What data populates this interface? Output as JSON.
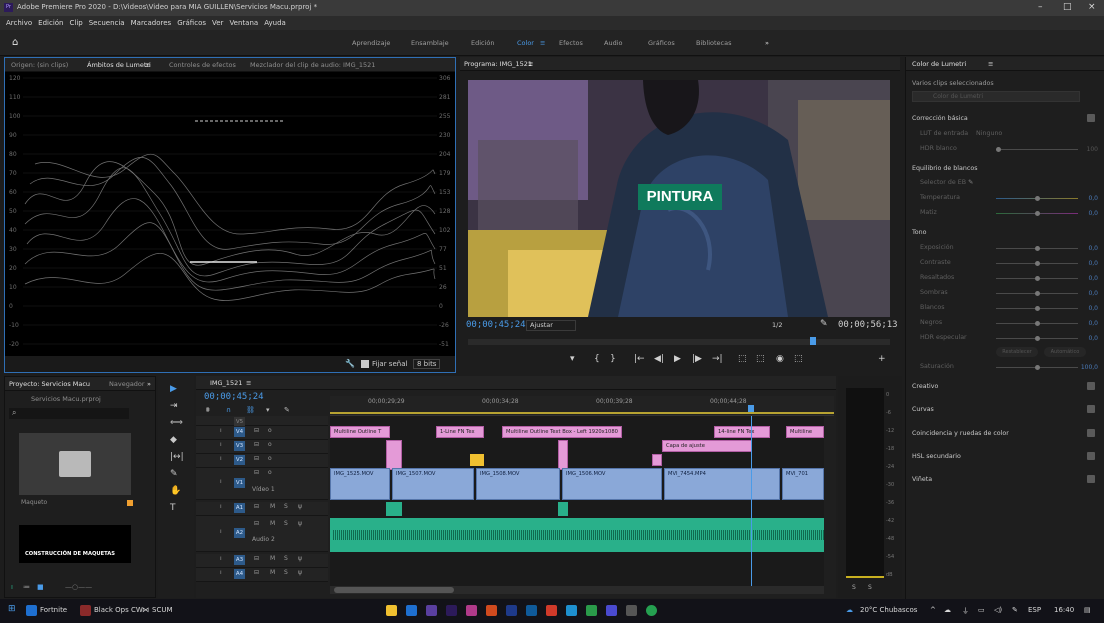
{
  "titlebar": {
    "title": "Adobe Premiere Pro 2020 - D:\\Videos\\Video para MIA GUILLEN\\Servicios Macu.prproj *",
    "app_icon": "Pr",
    "minimize": "–",
    "maximize": "□",
    "close": "×"
  },
  "menu": [
    "Archivo",
    "Edición",
    "Clip",
    "Secuencia",
    "Marcadores",
    "Gráficos",
    "Ver",
    "Ventana",
    "Ayuda"
  ],
  "workspaces": {
    "items": [
      "Aprendizaje",
      "Ensamblaje",
      "Edición",
      "Color",
      "Efectos",
      "Audio",
      "Gráficos",
      "Bibliotecas"
    ],
    "active": "Color",
    "more": "»",
    "menu_glyph": "≡"
  },
  "source_panel": {
    "tabs": [
      "Origen: (sin clips)",
      "Ámbitos de Lumetri",
      "Controles de efectos",
      "Mezclador del clip de audio: IMG_1521"
    ],
    "active_tab": "Ámbitos de Lumetri",
    "menu_glyph": "≡",
    "scale_left": [
      "120",
      "110",
      "100",
      "90",
      "80",
      "70",
      "60",
      "50",
      "40",
      "30",
      "20",
      "10",
      "0",
      "-10",
      "-20"
    ],
    "scale_right": [
      "306",
      "281",
      "255",
      "230",
      "204",
      "179",
      "153",
      "128",
      "102",
      "77",
      "51",
      "26",
      "0",
      "-26",
      "-51"
    ],
    "fijar_senal": "Fijar señal",
    "bits": "8 bits"
  },
  "program": {
    "title": "Programa: IMG_1521",
    "menu_glyph": "≡",
    "overlay_text": "PINTURA",
    "timecode_current": "00;00;45;24",
    "fit": "Ajustar",
    "resolution": "1/2",
    "timecode_total": "00;00;56;13",
    "controls": [
      "▾",
      "{",
      "}",
      "|←",
      "◀|",
      "▶",
      "|▶",
      "→|",
      "⬚",
      "⬚",
      "◉",
      "⬚",
      "+"
    ]
  },
  "lumetri": {
    "title": "Color de Lumetri",
    "menu_glyph": "≡",
    "selection_label": "Varios clips seleccionados",
    "selection_value": "Color de Lumetri",
    "sections": {
      "basic": "Corrección básica",
      "lut_label": "LUT de entrada",
      "lut_value": "Ninguno",
      "hdr_label": "HDR blanco",
      "hdr_value": "100",
      "white_balance": "Equilibrio de blancos",
      "wb_selector": "Selector de EB",
      "wb_sliders": [
        {
          "label": "Temperatura",
          "value": "0,0"
        },
        {
          "label": "Matiz",
          "value": "0,0"
        }
      ],
      "tone": "Tono",
      "tone_sliders": [
        {
          "label": "Exposición",
          "value": "0,0"
        },
        {
          "label": "Contraste",
          "value": "0,0"
        },
        {
          "label": "Resaltados",
          "value": "0,0"
        },
        {
          "label": "Sombras",
          "value": "0,0"
        },
        {
          "label": "Blancos",
          "value": "0,0"
        },
        {
          "label": "Negros",
          "value": "0,0"
        },
        {
          "label": "HDR especular",
          "value": "0,0"
        }
      ],
      "reset": "Restablecer",
      "auto": "Automático",
      "saturation": {
        "label": "Saturación",
        "value": "100,0"
      },
      "collapsed": [
        "Creativo",
        "Curvas",
        "Coincidencia y ruedas de color",
        "HSL secundario",
        "Viñeta"
      ]
    }
  },
  "project": {
    "tabs": [
      "Proyecto: Servicios Macu",
      "Navegador"
    ],
    "more": "»",
    "file": "Servicios Macu.prproj",
    "item_folder": "Maqueto",
    "item_clip_text": "CONSTRUCCIÓN DE MAQUETAS"
  },
  "tools": [
    "▶",
    "⇥",
    "⟺",
    "◆",
    "|↔|",
    "✎",
    "✋",
    "T"
  ],
  "timeline": {
    "tab": "IMG_1521",
    "menu_glyph": "≡",
    "timecode": "00;00;45;24",
    "ruler": [
      "00;00;29;29",
      "00;00;34;28",
      "00;00;39;28",
      "00;00;44;28"
    ],
    "video_tracks": [
      "V5",
      "V4",
      "V3",
      "V2",
      "V1"
    ],
    "video_1_name": "Vídeo 1",
    "audio_tracks": [
      "A1",
      "A2",
      "A3",
      "A4"
    ],
    "audio_2_name": "Audio 2",
    "clips_v4": [
      "Multiline Outline T",
      "1-Line FN Tex",
      "Multiline Outline Text Box - Left 1920x1080",
      "14-line FN Tex",
      "Multiline"
    ],
    "clips_v3": [
      "Capa de ajuste"
    ],
    "clips_v1": [
      "IMG_1525.MOV",
      "IMG_1507.MOV",
      "IMG_1508.MOV",
      "IMG_1506.MOV",
      "MVI_7454.MP4",
      "MVI_701"
    ],
    "track_glyphs": {
      "lock": "ı",
      "sync": "⊟",
      "eye": "o",
      "mute": "M",
      "solo": "S",
      "mic": "ψ"
    }
  },
  "meters": {
    "scale": [
      "0",
      "-6",
      "-12",
      "-18",
      "-24",
      "-30",
      "-36",
      "-42",
      "-48",
      "-54",
      "dB"
    ],
    "solo_labels": [
      "S",
      "S"
    ]
  },
  "taskbar": {
    "items": [
      "Fortnite",
      "Black Ops CW",
      "SCUM"
    ],
    "weather": "20°C Chubascos",
    "lang": "ESP",
    "time": "16:40"
  },
  "colors": {
    "accent": "#4a9be8",
    "title_green": "#0f7a5c",
    "clip_pink": "#e49ad7",
    "clip_blue": "#8aa8d8",
    "audio_green": "#29b08a"
  }
}
